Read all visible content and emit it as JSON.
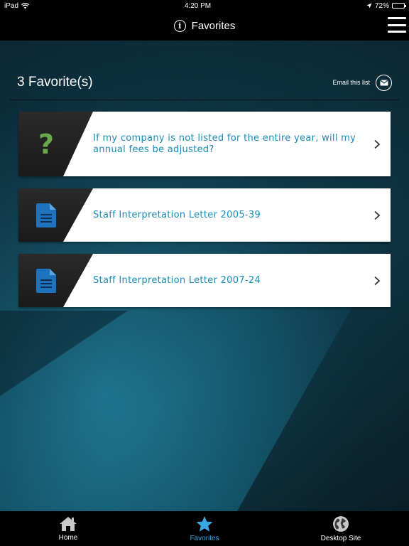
{
  "status_bar": {
    "device": "iPad",
    "time": "4:20 PM",
    "battery": "72%",
    "battery_level": 0.72
  },
  "nav": {
    "title": "Favorites"
  },
  "header": {
    "count_label": "3 Favorite(s)",
    "email_label": "Email this list"
  },
  "favorites": [
    {
      "type": "question",
      "icon": "question-icon",
      "text": "If my company is not listed for the entire year, will my annual fees be adjusted?"
    },
    {
      "type": "document",
      "icon": "document-icon",
      "text": "Staff Interpretation Letter 2005-39"
    },
    {
      "type": "document",
      "icon": "document-icon",
      "text": "Staff Interpretation Letter 2007-24"
    }
  ],
  "tabs": [
    {
      "label": "Home",
      "icon": "home-icon",
      "active": false
    },
    {
      "label": "Favorites",
      "icon": "star-icon",
      "active": true
    },
    {
      "label": "Desktop Site",
      "icon": "globe-icon",
      "active": false
    }
  ],
  "colors": {
    "accent": "#3aa6e0",
    "link_text": "#1a8bb5",
    "question_green": "#6aa84f",
    "doc_blue": "#1e73be"
  }
}
